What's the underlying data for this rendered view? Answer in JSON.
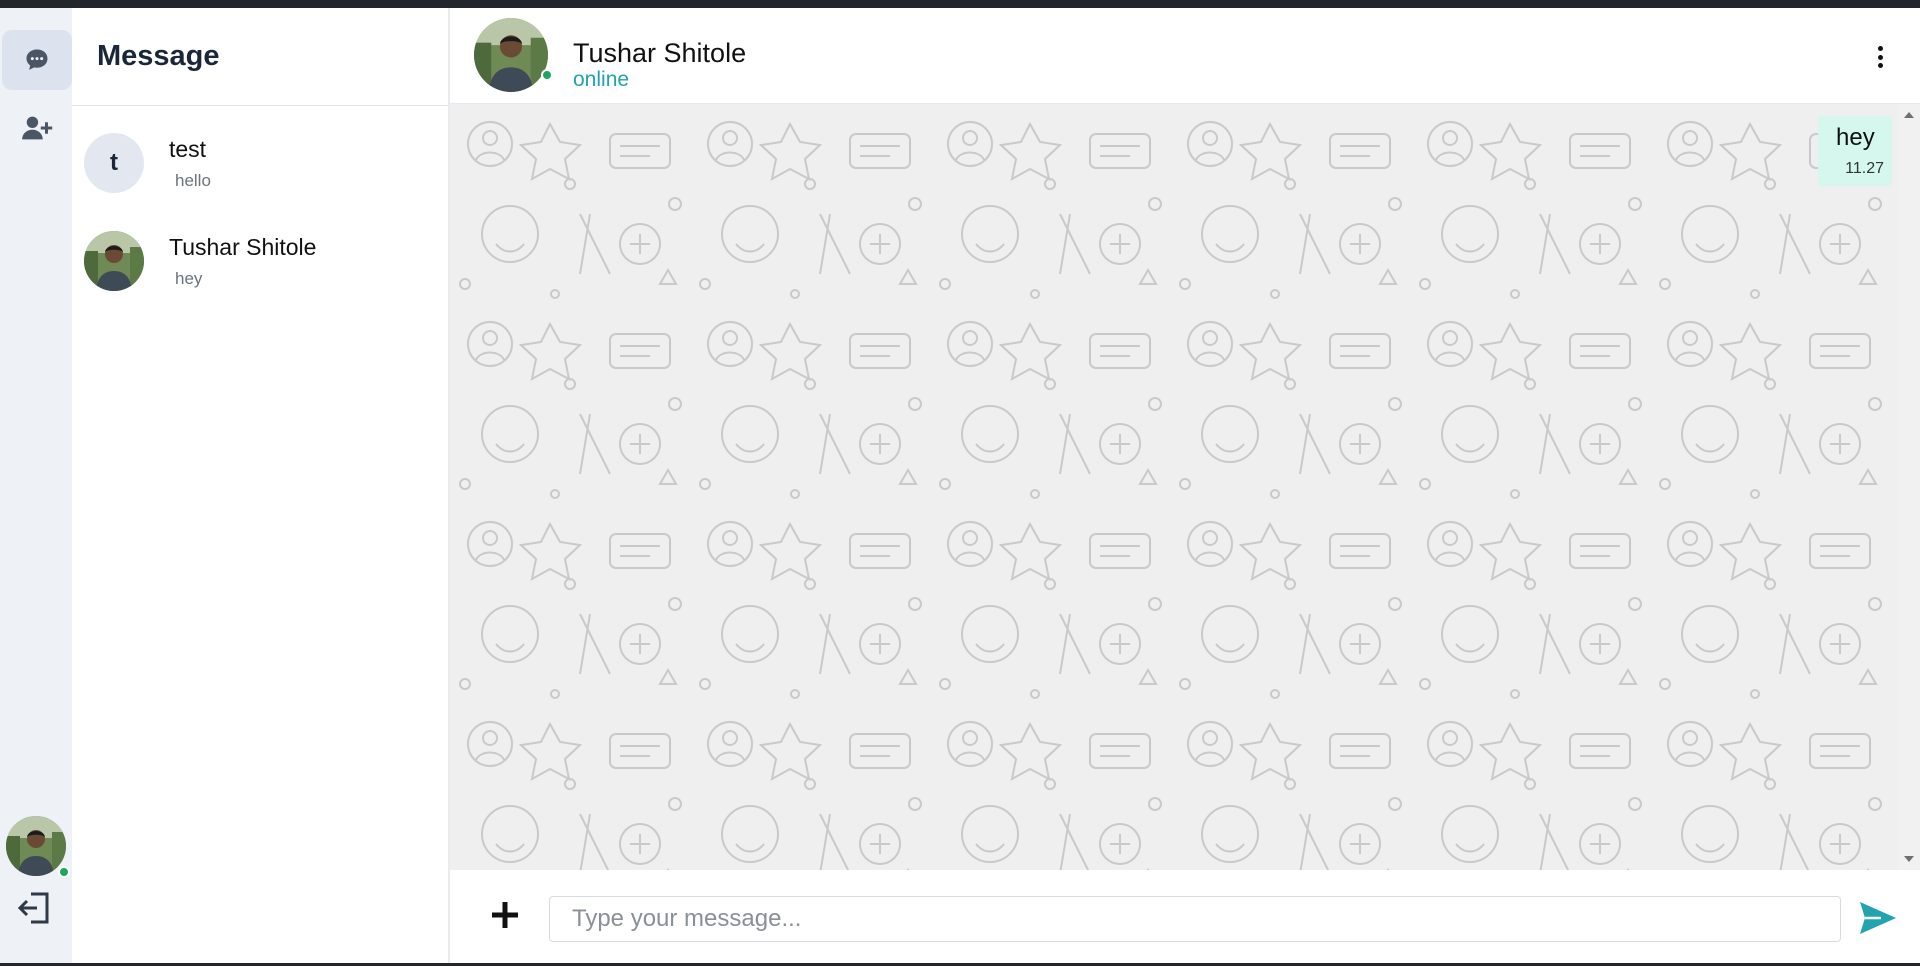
{
  "app": {
    "sidebar_title": "Message"
  },
  "rail": {
    "items": [
      {
        "name": "chats",
        "icon": "chat-bubble-icon",
        "active": true
      },
      {
        "name": "add-contact",
        "icon": "user-plus-icon",
        "active": false
      }
    ],
    "bottom": {
      "avatar": "user-avatar",
      "online": true,
      "logout_icon": "logout-icon"
    }
  },
  "conversations": [
    {
      "name": "test",
      "last_message": "hello",
      "avatar_letter": "t",
      "avatar_type": "letter"
    },
    {
      "name": "Tushar Shitole",
      "last_message": "hey",
      "avatar_type": "photo"
    }
  ],
  "chat": {
    "contact_name": "Tushar Shitole",
    "status": "online",
    "menu_icon": "kebab-menu-icon",
    "messages": [
      {
        "text": "hey",
        "time": "11.27",
        "outgoing": true
      }
    ]
  },
  "composer": {
    "placeholder": "Type your message...",
    "value": "",
    "attach_icon": "plus-icon",
    "send_icon": "send-icon"
  },
  "colors": {
    "accent": "#21a3b0",
    "online": "#1ea55f",
    "bubble": "#d5f7ee",
    "rail": "#eef1f6",
    "wallpaper": "#efefef"
  }
}
